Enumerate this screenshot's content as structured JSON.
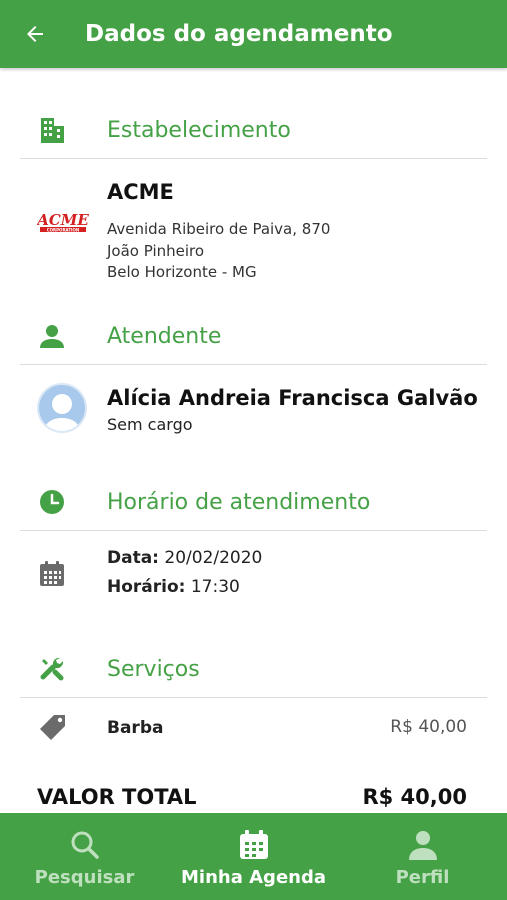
{
  "header": {
    "title": "Dados do agendamento"
  },
  "establishment": {
    "section_title": "Estabelecimento",
    "name": "ACME",
    "address_line": "Avenida Ribeiro de Paiva, 870",
    "district": "João Pinheiro",
    "city": "Belo Horizonte - MG",
    "logo_text": "ACME",
    "logo_subtext": "CORPORATION"
  },
  "attendant": {
    "section_title": "Atendente",
    "name": "Alícia Andreia Francisca Galvão",
    "role": "Sem cargo"
  },
  "schedule": {
    "section_title": "Horário de atendimento",
    "date_label": "Data:",
    "date_value": "20/02/2020",
    "time_label": "Horário:",
    "time_value": "17:30"
  },
  "services": {
    "section_title": "Serviços",
    "items": [
      {
        "name": "Barba",
        "price": "R$ 40,00"
      }
    ]
  },
  "total": {
    "label": "VALOR TOTAL",
    "value": "R$ 40,00"
  },
  "bottom_nav": {
    "items": [
      {
        "label": "Pesquisar",
        "icon": "search-icon",
        "active": false
      },
      {
        "label": "Minha Agenda",
        "icon": "calendar-icon",
        "active": true
      },
      {
        "label": "Perfil",
        "icon": "person-icon",
        "active": false
      }
    ]
  },
  "colors": {
    "primary": "#45a146",
    "nav_inactive": "#bfe0bf",
    "icon_gray": "#6b6b6b"
  }
}
